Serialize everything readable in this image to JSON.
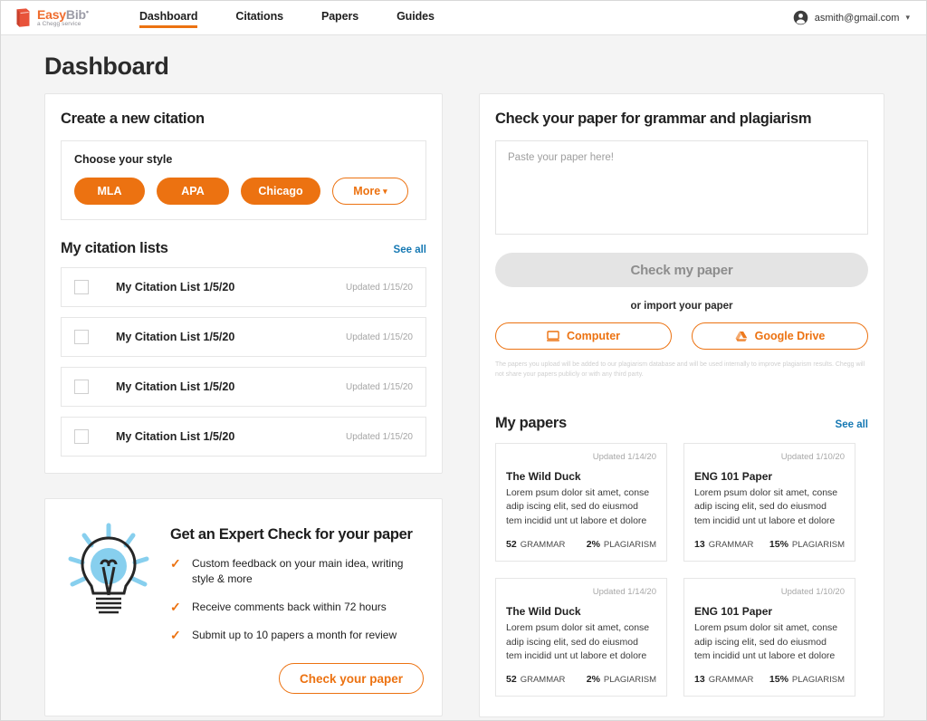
{
  "header": {
    "logo": {
      "name_primary": "Easy",
      "name_secondary": "Bib",
      "tagline": "a Chegg service",
      "icon": "book-icon"
    },
    "nav": [
      {
        "label": "Dashboard",
        "active": true
      },
      {
        "label": "Citations",
        "active": false
      },
      {
        "label": "Papers",
        "active": false
      },
      {
        "label": "Guides",
        "active": false
      }
    ],
    "account": {
      "email": "asmith@gmail.com",
      "avatar_icon": "account-circle-icon",
      "caret_icon": "chevron-down-icon"
    }
  },
  "page": {
    "title": "Dashboard"
  },
  "create_citation": {
    "title": "Create a new citation",
    "style_label": "Choose your style",
    "styles": [
      {
        "label": "MLA",
        "variant": "solid"
      },
      {
        "label": "APA",
        "variant": "solid"
      },
      {
        "label": "Chicago",
        "variant": "solid"
      },
      {
        "label": "More",
        "variant": "ghost",
        "icon": "chevron-down-icon"
      }
    ]
  },
  "citation_lists": {
    "title": "My citation lists",
    "see_all": "See all",
    "items": [
      {
        "name": "My Citation List 1/5/20",
        "updated": "Updated 1/15/20",
        "checked": false
      },
      {
        "name": "My Citation List 1/5/20",
        "updated": "Updated 1/15/20",
        "checked": false
      },
      {
        "name": "My Citation List 1/5/20",
        "updated": "Updated 1/15/20",
        "checked": false
      },
      {
        "name": "My Citation List 1/5/20",
        "updated": "Updated 1/15/20",
        "checked": false
      }
    ]
  },
  "expert_check": {
    "title": "Get an Expert Check for your paper",
    "icon": "lightbulb-icon",
    "bullets": [
      "Custom feedback on your main idea, writing style & more",
      "Receive comments back within 72 hours",
      "Submit up to 10 papers a month for review"
    ],
    "cta": "Check your paper"
  },
  "grammar_panel": {
    "title": "Check your paper for grammar and plagiarism",
    "textarea": {
      "value": "",
      "placeholder": "Paste your paper here!"
    },
    "submit_label": "Check my paper",
    "or_import": "or import your paper",
    "import_buttons": [
      {
        "label": "Computer",
        "icon": "computer-icon"
      },
      {
        "label": "Google Drive",
        "icon": "google-drive-icon"
      }
    ],
    "disclaimer": "The papers you upload will be added to our plagiarism database and will be used internally to improve plagiarism results. Chegg will not share your papers publicly or with any third party."
  },
  "my_papers": {
    "title": "My papers",
    "see_all": "See all",
    "grammar_label": "GRAMMAR",
    "plagiarism_label": "PLAGIARISM",
    "cards": [
      {
        "updated": "Updated 1/14/20",
        "title": "The Wild Duck",
        "excerpt": "Lorem psum dolor sit amet, conse adip iscing elit, sed do eiusmod tem incidid unt ut labore et dolore",
        "grammar": "52",
        "plagiarism": "2%"
      },
      {
        "updated": "Updated 1/10/20",
        "title": "ENG 101 Paper",
        "excerpt": "Lorem psum dolor sit amet, conse adip iscing elit, sed do eiusmod tem incidid unt ut labore et dolore",
        "grammar": "13",
        "plagiarism": "15%"
      },
      {
        "updated": "Updated 1/14/20",
        "title": "The Wild Duck",
        "excerpt": "Lorem psum dolor sit amet, conse adip iscing elit, sed do eiusmod tem incidid unt ut labore et dolore",
        "grammar": "52",
        "plagiarism": "2%"
      },
      {
        "updated": "Updated 1/10/20",
        "title": "ENG 101 Paper",
        "excerpt": "Lorem psum dolor sit amet, conse adip iscing elit, sed do eiusmod tem incidid unt ut labore et dolore",
        "grammar": "13",
        "plagiarism": "15%"
      }
    ]
  },
  "colors": {
    "brand_orange": "#ec7211",
    "logo_red": "#e8533a",
    "link_blue": "#1578b3",
    "bulb_blue": "#87cfee",
    "page_bg": "#f4f4f4"
  }
}
